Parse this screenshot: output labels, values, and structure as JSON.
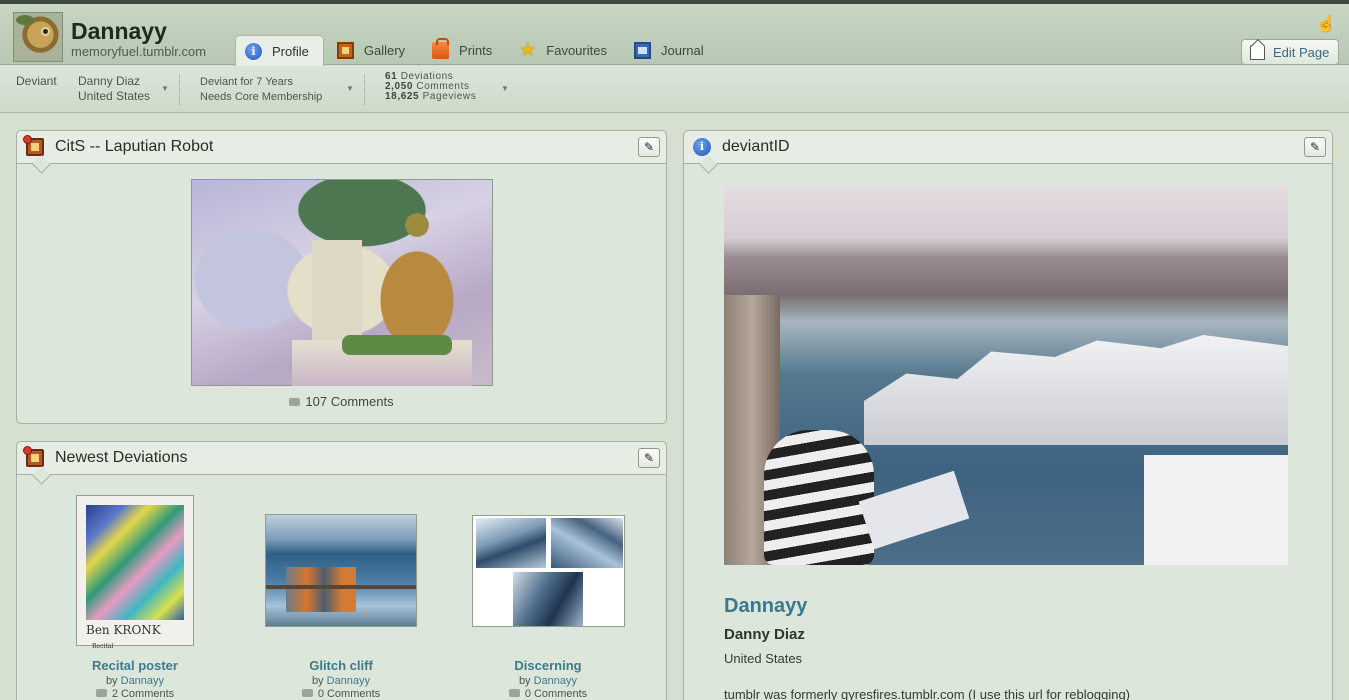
{
  "header": {
    "username": "Dannayy",
    "site": "memoryfuel.tumblr.com",
    "tabs": [
      {
        "label": "Profile",
        "icon": "info-icon",
        "active": true
      },
      {
        "label": "Gallery",
        "icon": "gallery-icon"
      },
      {
        "label": "Prints",
        "icon": "prints-icon"
      },
      {
        "label": "Favourites",
        "icon": "star-icon"
      },
      {
        "label": "Journal",
        "icon": "journal-icon"
      }
    ],
    "edit_page_label": "Edit Page"
  },
  "stats": {
    "type_label": "Deviant",
    "real_name": "Danny Diaz",
    "country": "United States",
    "deviant_for": "Deviant for 7 Years",
    "membership": "Needs Core Membership",
    "deviations_count": "61",
    "deviations_label": "Deviations",
    "comments_count": "2,050",
    "comments_label": "Comments",
    "pageviews_count": "18,625",
    "pageviews_label": "Pageviews"
  },
  "featured": {
    "title": "CitS -- Laputian Robot",
    "comments": "107 Comments"
  },
  "newest": {
    "title": "Newest Deviations",
    "by_prefix": "by",
    "items": [
      {
        "title": "Recital poster",
        "author": "Dannayy",
        "comments": "2 Comments",
        "poster_text": "Ben KRONK",
        "poster_small": "Recital"
      },
      {
        "title": "Glitch cliff",
        "author": "Dannayy",
        "comments": "0 Comments"
      },
      {
        "title": "Discerning",
        "author": "Dannayy",
        "comments": "0 Comments"
      }
    ]
  },
  "deviantid": {
    "title": "deviantID",
    "username": "Dannayy",
    "real_name": "Danny Diaz",
    "country": "United States",
    "bio": "tumblr was formerly gyresfires.tumblr.com (I use this url for reblogging)"
  },
  "colors": {
    "background": "#d5e0d1",
    "link": "#3d7a8c",
    "username_link": "#3a7891"
  }
}
